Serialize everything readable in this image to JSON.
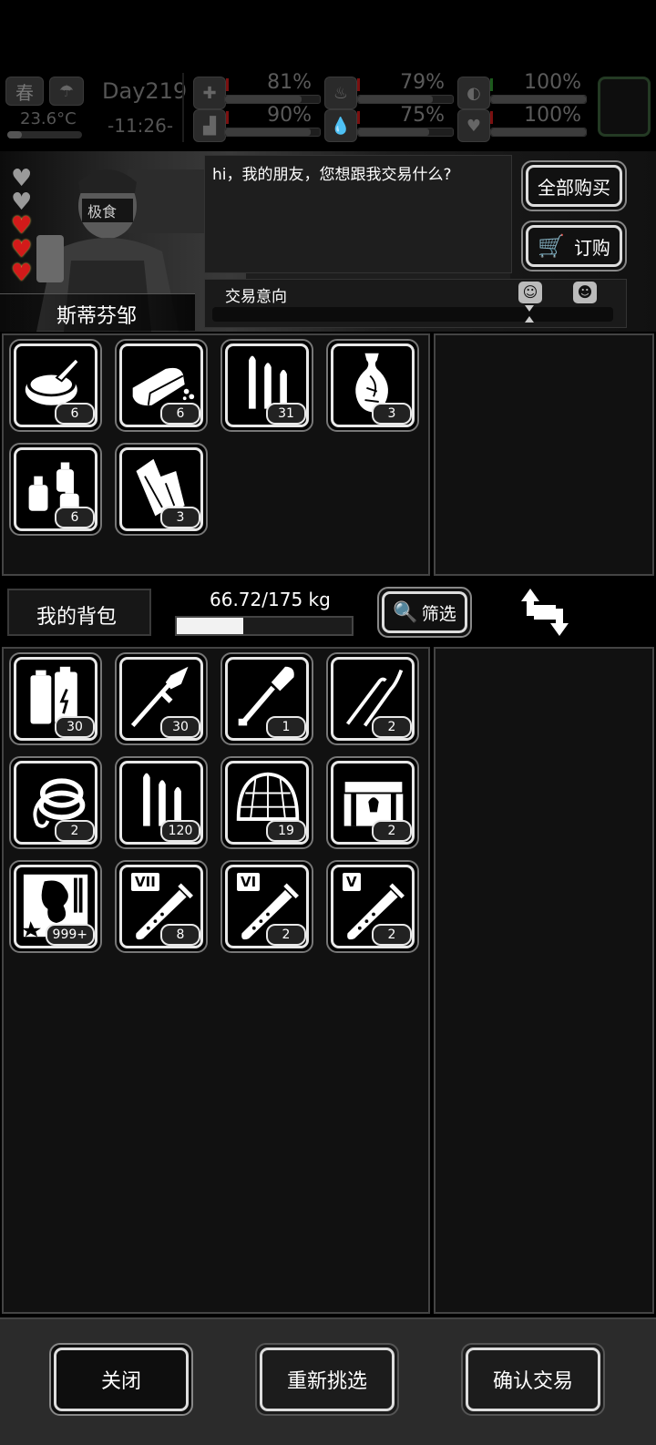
{
  "status": {
    "season": "春",
    "temperature": "23.6°C",
    "day": "Day219",
    "time": "-11:26-",
    "stats_row1": [
      {
        "icon": "medkit-icon",
        "value": "81%",
        "level": 0.81
      },
      {
        "icon": "stomach-icon",
        "value": "79%",
        "level": 0.79
      },
      {
        "icon": "pill-icon",
        "value": "100%",
        "level": 1.0
      }
    ],
    "stats_row2": [
      {
        "icon": "boot-icon",
        "value": "90%",
        "level": 0.9
      },
      {
        "icon": "water-drop-icon",
        "value": "75%",
        "level": 0.75
      },
      {
        "icon": "heart-health-icon",
        "value": "100%",
        "level": 1.0
      }
    ]
  },
  "trader": {
    "name": "斯蒂芬邹",
    "hearts_full": 3,
    "hearts_empty": 2,
    "dialog": "hi，我的朋友，您想跟我交易什么?",
    "intent_label": "交易意向"
  },
  "buttons": {
    "buy_all": "全部购买",
    "order": "订购",
    "filter": "筛选",
    "close": "关闭",
    "reselect": "重新挑选",
    "confirm": "确认交易"
  },
  "trader_items": [
    {
      "icon": "canned-food-icon",
      "count": "6"
    },
    {
      "icon": "bread-icon",
      "count": "6"
    },
    {
      "icon": "bullets-icon",
      "count": "31"
    },
    {
      "icon": "vase-icon",
      "count": "3"
    },
    {
      "icon": "spray-bottles-icon",
      "count": "6"
    },
    {
      "icon": "bandage-rolls-icon",
      "count": "3"
    }
  ],
  "backpack": {
    "label": "我的背包",
    "weight": "66.72/175 kg",
    "weight_fraction": 0.381
  },
  "backpack_items": [
    {
      "icon": "battery-icon",
      "count": "30"
    },
    {
      "icon": "rocket-icon",
      "count": "30"
    },
    {
      "icon": "shovel-icon",
      "count": "1"
    },
    {
      "icon": "lockpick-icon",
      "count": "2"
    },
    {
      "icon": "rope-icon",
      "count": "2"
    },
    {
      "icon": "bullets-icon",
      "count": "120"
    },
    {
      "icon": "net-icon",
      "count": "19"
    },
    {
      "icon": "chest-icon",
      "count": "2"
    },
    {
      "icon": "map-fragment-icon",
      "count": "999+"
    },
    {
      "icon": "test-tube-vii-icon",
      "count": "8",
      "tier": "VII"
    },
    {
      "icon": "test-tube-vi-icon",
      "count": "2",
      "tier": "VI"
    },
    {
      "icon": "test-tube-v-icon",
      "count": "2",
      "tier": "V"
    }
  ]
}
